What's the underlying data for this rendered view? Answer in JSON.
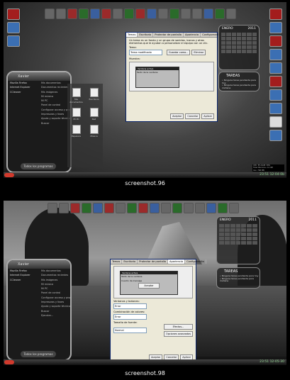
{
  "captions": {
    "first": "screenshot.96",
    "second": "screenshot.98"
  },
  "start_menu": {
    "user_name": "Xavier",
    "left_items": [
      "Mozilla Firefox",
      "Internet Explorer",
      "CCleaner",
      "",
      "",
      "",
      "",
      "",
      ""
    ],
    "right_items": [
      "Mis documentos",
      "Documentos recientes",
      "Mis imágenes",
      "Mi música",
      "Mi PC",
      "Panel de control",
      "Configurar acceso y programas",
      "Impresoras y faxes",
      "Ayuda y soporte técnico",
      "Buscar",
      "Ejecutar..."
    ],
    "footer": "Todos los programas"
  },
  "display_window": {
    "tabs": [
      "Temas",
      "Escritorio",
      "Protector de pantalla",
      "Apariencia",
      "Configuración"
    ],
    "description": "Un tema es un fondo y un grupo de sonidos, iconos y otros elementos que le ayudan a personalizar el equipo con un clic.",
    "theme_label": "Tema:",
    "theme_value": "Tema modificado",
    "save_as_label": "Guardar como...",
    "delete_label": "Eliminar",
    "preview_label": "Muestra:",
    "preview_window_title": "Ventana activa",
    "preview_window_text": "Texto de la ventana",
    "accept_label": "Aceptar",
    "cancel_label": "Cancelar",
    "apply_label": "Aplicar"
  },
  "appearance_window": {
    "tabs": [
      "Temas",
      "Escritorio",
      "Protector de pantalla",
      "Apariencia",
      "Configuración"
    ],
    "preview_active": "Ventana activa",
    "preview_text": "Texto de la ventana",
    "preview_msg": "Cuadro de mensaje",
    "preview_ok": "Aceptar",
    "style_label": "Ventanas y botones:",
    "style_value": "Error",
    "color_label": "Combinación de colores:",
    "color_value": "Error",
    "size_label": "Tamaño de fuente:",
    "size_value": "Normal",
    "effects_label": "Efectos...",
    "advanced_label": "Opciones avanzadas",
    "accept_label": "Aceptar",
    "cancel_label": "Cancelar",
    "apply_label": "Aplicar"
  },
  "calendar": {
    "month": "ENERO",
    "year": "2011"
  },
  "tasks": {
    "title": "TAREAS",
    "note_1": "• Ninguna tarea pendiente para hoy",
    "note_2": "• Ninguna tarea pendiente para mañana"
  },
  "tray": {
    "line1": "CPU: 8%  RAM: 38%",
    "line2": "Total Memoria: 2.0 GB",
    "line3": "Uso: 768 MB"
  },
  "clocks": {
    "first": "23:51  12-04-0b",
    "second": "23:51  12-05-30"
  },
  "file_panel": {
    "items": [
      "Mis documentos",
      "Escritorio",
      "Mi PC",
      "Red",
      "Papelera",
      "Música",
      "Imágenes",
      "Vídeos",
      "Descargas"
    ]
  },
  "colors": {
    "accent_red": "#d13a2d",
    "window_bg": "#ece9d8",
    "clock_green": "#8fd18f"
  }
}
